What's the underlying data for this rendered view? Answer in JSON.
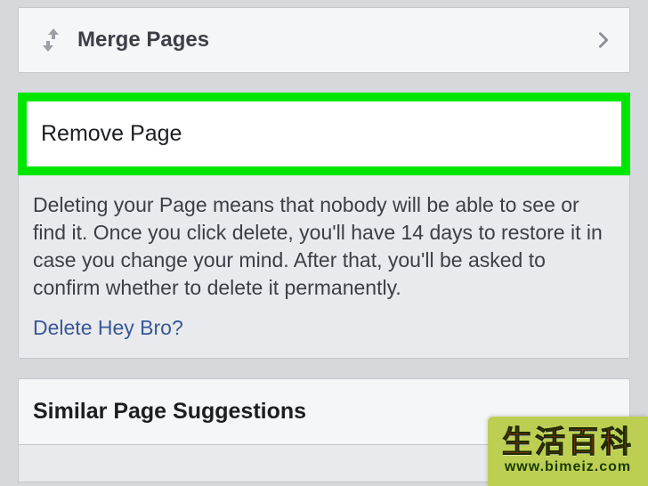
{
  "merge": {
    "title": "Merge Pages"
  },
  "remove": {
    "header": "Remove Page",
    "description": "Deleting your Page means that nobody will be able to see or find it. Once you click delete, you'll have 14 days to restore it in case you change your mind. After that, you'll be asked to confirm whether to delete it permanently.",
    "delete_link": "Delete Hey Bro?"
  },
  "similar": {
    "header": "Similar Page Suggestions"
  },
  "watermark": {
    "title": "生活百科",
    "url": "www.bimeiz.com"
  }
}
